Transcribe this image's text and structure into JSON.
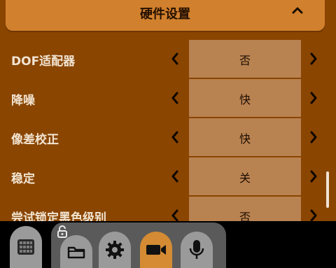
{
  "header": {
    "title": "硬件设置"
  },
  "rows": [
    {
      "label": "DOF适配器",
      "value": "否"
    },
    {
      "label": "降噪",
      "value": "快"
    },
    {
      "label": "像差校正",
      "value": "快"
    },
    {
      "label": "稳定",
      "value": "关"
    },
    {
      "label": "尝试锁定黑色级别",
      "value": "否"
    }
  ],
  "colors": {
    "panel_bg": "#8a4500",
    "header_bg": "#d1802d",
    "value_bg": "#b98251",
    "active_tab": "#d48b33"
  },
  "icons": [
    "chevron-up-icon",
    "chevron-left-icon",
    "chevron-right-icon",
    "grid-icon",
    "lock-icon",
    "folder-icon",
    "gear-icon",
    "video-camera-icon",
    "microphone-icon"
  ]
}
